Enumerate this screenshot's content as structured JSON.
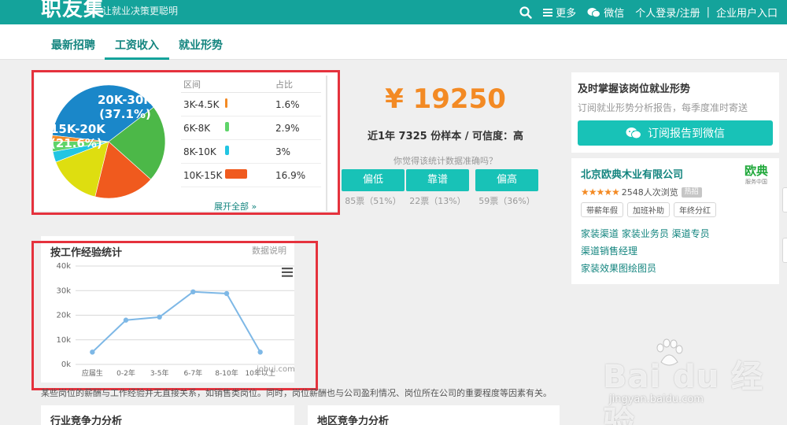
{
  "header": {
    "logo": "职友集",
    "slogan": "让就业决策更聪明",
    "more": "更多",
    "wechat": "微信",
    "login": "个人登录/注册",
    "separator": "|",
    "enterprise": "企业用户入口"
  },
  "tabs": [
    {
      "label": "最新招聘",
      "active": false
    },
    {
      "label": "工资收入",
      "active": true
    },
    {
      "label": "就业形势",
      "active": false
    }
  ],
  "salary_distribution": {
    "pie_labels": [
      {
        "range": "20K-30K",
        "pct": "(37.1%)"
      },
      {
        "range": "15K-20K",
        "pct": "(21.6%)"
      }
    ],
    "table_header": {
      "range": "区间",
      "ratio": "占比"
    },
    "rows": [
      {
        "range": "3K-4.5K",
        "ratio": "1.6%",
        "color": "#f38a24"
      },
      {
        "range": "6K-8K",
        "ratio": "2.9%",
        "color": "#5fd46a"
      },
      {
        "range": "8K-10K",
        "ratio": "3%",
        "color": "#22c5e2"
      },
      {
        "range": "10K-15K",
        "ratio": "16.9%",
        "color": "#f05a1e"
      }
    ],
    "expand_all": "展开全部 »"
  },
  "salary_summary": {
    "price": "¥ 19250",
    "sample_text": "近1年 7325 份样本 / 可信度：高",
    "question": "你觉得该统计数据准确吗？",
    "votes": [
      {
        "label": "偏低",
        "count": "85票（51%）"
      },
      {
        "label": "靠谱",
        "count": "22票（13%）"
      },
      {
        "label": "偏高",
        "count": "59票（36%）"
      }
    ]
  },
  "experience_chart": {
    "title": "按工作经验统计",
    "help": "数据说明",
    "watermark": "jobui.com"
  },
  "chart_data": [
    {
      "type": "pie",
      "slices": [
        {
          "label": "20K-30K",
          "value": 37.1,
          "color": "#1a87c9"
        },
        {
          "label": "15K-20K",
          "value": 21.6,
          "color": "#4cb848"
        },
        {
          "label": "10K-15K",
          "value": 16.9,
          "color": "#f05a1e"
        },
        {
          "label": "",
          "value": 15.0,
          "color": "#dede10"
        },
        {
          "label": "8K-10K",
          "value": 3.0,
          "color": "#22c5e2"
        },
        {
          "label": "6K-8K",
          "value": 2.9,
          "color": "#5fd46a"
        },
        {
          "label": "3K-4.5K",
          "value": 1.6,
          "color": "#f38a24"
        }
      ]
    },
    {
      "type": "line",
      "categories": [
        "应届生",
        "0-2年",
        "3-5年",
        "6-7年",
        "8-10年",
        "10年以上"
      ],
      "values": [
        5000,
        18000,
        19250,
        29500,
        28800,
        5000
      ],
      "yticks": [
        "0k",
        "10k",
        "20k",
        "30k",
        "40k"
      ],
      "ylim": [
        0,
        40000
      ],
      "grid": true,
      "color": "#7eb8e6"
    }
  ],
  "footnote": "某些岗位的薪酬与工作经验并无直接关系，如销售类岗位。同时，岗位薪酬也与公司盈利情况、岗位所在公司的重要程度等因素有关。",
  "bottom_cards": {
    "industry": "行业竞争力分析",
    "region": "地区竞争力分析"
  },
  "subscribe": {
    "title": "及时掌握该岗位就业形势",
    "desc": "订阅就业形势分析报告，每季度准时寄送",
    "button": "订阅报告到微信"
  },
  "company": {
    "name": "北京欧典木业有限公司",
    "logo_text": "欧典",
    "logo_sub": "服务中国",
    "views": "2548人次浏览",
    "hot": "热招",
    "tags": [
      "带薪年假",
      "加班补助",
      "年终分红"
    ],
    "links_line1": "家装渠道 家装业务员 渠道专员",
    "links_line2": "渠道销售经理",
    "links_line3": "家装效果图绘图员"
  },
  "baidu": {
    "brand": "Bai du 经验",
    "url": "jingyan.baidu.com"
  }
}
